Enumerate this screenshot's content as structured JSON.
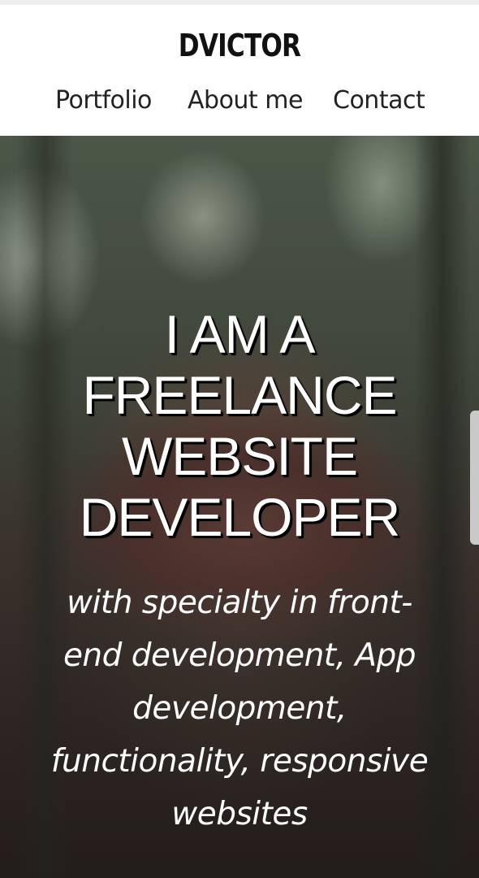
{
  "site": {
    "logo": "DVICTOR"
  },
  "nav": {
    "items": [
      {
        "label": "Portfolio"
      },
      {
        "label": "About me"
      },
      {
        "label": "Contact"
      }
    ]
  },
  "hero": {
    "title_lines": [
      "I AM A",
      "FREELANCE",
      "WEBSITE",
      "DEVELOPER"
    ],
    "subtitle_lines": [
      "with specialty in front-",
      "end development, App",
      "development,",
      "functionality, responsive",
      "websites"
    ]
  },
  "colors": {
    "header_bg": "#ffffff",
    "text_dark": "#111111",
    "hero_text": "#ffffff",
    "hero_text_shadow": "#000000"
  }
}
